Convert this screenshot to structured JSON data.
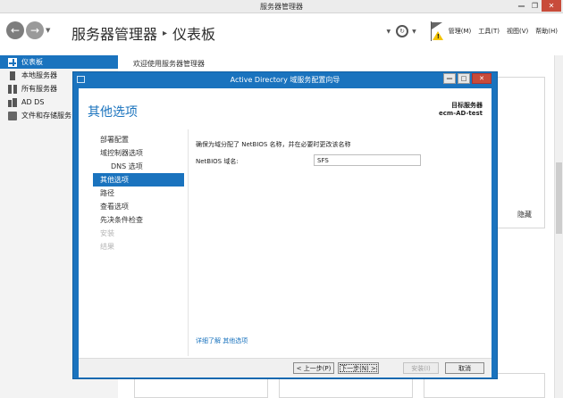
{
  "window": {
    "title": "服务器管理器"
  },
  "header": {
    "breadcrumb_root": "服务器管理器",
    "breadcrumb_separator": "▸",
    "breadcrumb_current": "仪表板",
    "menu_manage": "管理(M)",
    "menu_tools": "工具(T)",
    "menu_view": "视图(V)",
    "menu_help": "帮助(H)"
  },
  "sidebar": {
    "items": [
      {
        "label": "仪表板",
        "icon": "dashboard-icon",
        "active": true
      },
      {
        "label": "本地服务器",
        "icon": "server-icon"
      },
      {
        "label": "所有服务器",
        "icon": "servers-icon"
      },
      {
        "label": "AD DS",
        "icon": "ad-ds-icon"
      },
      {
        "label": "文件和存储服务",
        "icon": "storage-icon"
      }
    ]
  },
  "main": {
    "welcome": "欢迎使用服务器管理器",
    "hide_label": "隐藏"
  },
  "dialog": {
    "title": "Active Directory 域服务配置向导",
    "heading": "其他选项",
    "target_label": "目标服务器",
    "target_name": "ecm-AD-test",
    "nav": [
      {
        "label": "部署配置"
      },
      {
        "label": "域控制器选项"
      },
      {
        "label": "DNS 选项",
        "sub": true
      },
      {
        "label": "其他选项",
        "active": true
      },
      {
        "label": "路径"
      },
      {
        "label": "查看选项"
      },
      {
        "label": "先决条件检查"
      },
      {
        "label": "安装",
        "disabled": true
      },
      {
        "label": "结果",
        "disabled": true
      }
    ],
    "description": "确保为域分配了 NetBIOS 名称，并在必要时更改该名称",
    "netbios_label": "NetBIOS 域名:",
    "netbios_value": "SFS",
    "more_link": "详细了解 其他选项",
    "buttons": {
      "prev": "< 上一步(P)",
      "next": "下一步(N) >",
      "install": "安装(I)",
      "cancel": "取消"
    }
  },
  "colors": {
    "accent": "#1a73be",
    "close_red": "#c84b3a",
    "warning_yellow": "#f5c400"
  }
}
